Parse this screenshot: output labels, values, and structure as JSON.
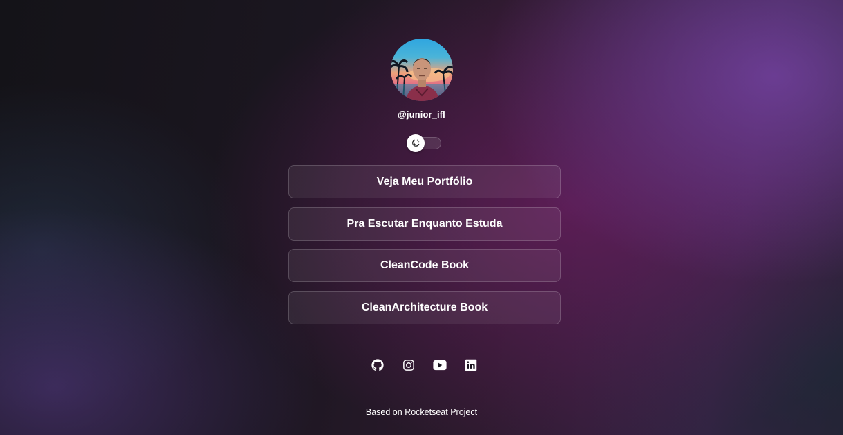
{
  "profile": {
    "username": "@junior_ifl",
    "avatar_alt": "avatar"
  },
  "theme_toggle": {
    "icon": "moon-icon",
    "state": "dark"
  },
  "links": [
    {
      "label": "Veja Meu Portfólio"
    },
    {
      "label": "Pra Escutar Enquanto Estuda"
    },
    {
      "label": "CleanCode Book"
    },
    {
      "label": "CleanArchitecture Book"
    }
  ],
  "socials": [
    {
      "icon": "github-icon"
    },
    {
      "icon": "instagram-icon"
    },
    {
      "icon": "youtube-icon"
    },
    {
      "icon": "linkedin-icon"
    }
  ],
  "footer": {
    "prefix": "Based on",
    "link_text": "Rocketseat",
    "suffix": "Project"
  },
  "colors": {
    "text": "#ffffff",
    "button_bg": "rgba(255,255,255,0.07)",
    "button_border": "rgba(255,255,255,0.18)"
  }
}
